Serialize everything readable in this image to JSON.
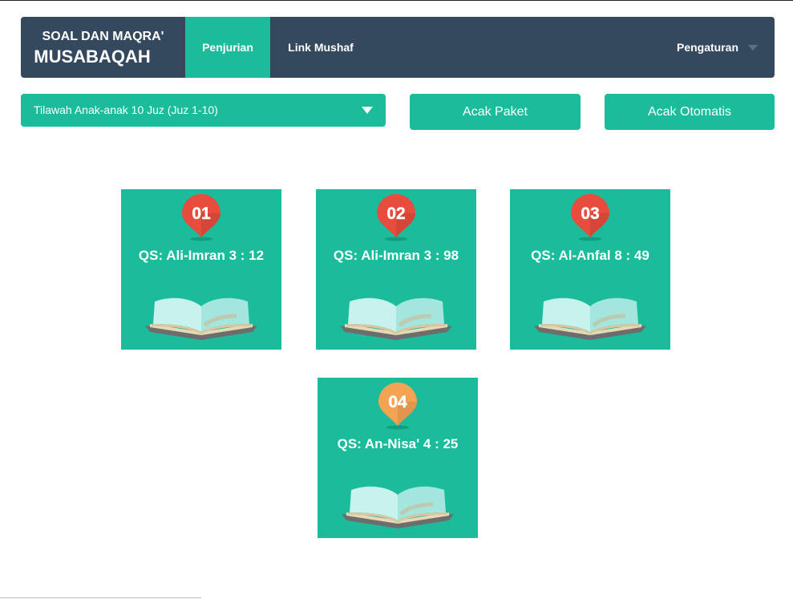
{
  "navbar": {
    "brand_line1": "SOAL DAN MAQRA'",
    "brand_line2": "MUSABAQAH",
    "tabs": [
      {
        "label": "Penjurian",
        "active": true
      },
      {
        "label": "Link Mushaf",
        "active": false
      }
    ],
    "settings_label": "Pengaturan"
  },
  "controls": {
    "category_selected": "Tilawah Anak-anak 10 Juz (Juz 1-10)",
    "acak_paket_label": "Acak Paket",
    "acak_otomatis_label": "Acak Otomatis"
  },
  "cards": [
    {
      "number": "01",
      "title": "QS: Ali-Imran 3 : 12",
      "pin_color": "#e74c3c",
      "icon": "book-icon"
    },
    {
      "number": "02",
      "title": "QS: Ali-Imran 3 : 98",
      "pin_color": "#e74c3c",
      "icon": "book-icon"
    },
    {
      "number": "03",
      "title": "QS: Al-Anfal 8 : 49",
      "pin_color": "#e74c3c",
      "icon": "book-icon"
    },
    {
      "number": "04",
      "title": "QS: An-Nisa' 4 : 25",
      "pin_color": "#f4a353",
      "icon": "book-icon"
    }
  ],
  "colors": {
    "navbar": "#34495e",
    "accent": "#1abc9c"
  }
}
